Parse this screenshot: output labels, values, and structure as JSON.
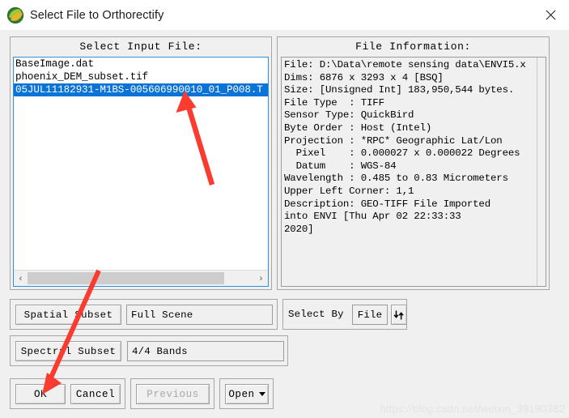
{
  "window": {
    "title": "Select File to Orthorectify",
    "icon": "envi-leaf-icon",
    "close_label": "close-icon"
  },
  "input_panel": {
    "title": "Select Input File:",
    "files": [
      {
        "name": "BaseImage.dat",
        "selected": false
      },
      {
        "name": "phoenix_DEM_subset.tif",
        "selected": false
      },
      {
        "name": "05JUL11182931-M1BS-005606990010_01_P008.T",
        "selected": true
      }
    ],
    "scroll_left_icon": "‹",
    "scroll_right_icon": "›"
  },
  "info_panel": {
    "title": "File Information:",
    "lines": [
      "File: D:\\Data\\remote sensing data\\ENVI5.x",
      "Dims: 6876 x 3293 x 4 [BSQ]",
      "Size: [Unsigned Int] 183,950,544 bytes.",
      "File Type  : TIFF",
      "Sensor Type: QuickBird",
      "Byte Order : Host (Intel)",
      "Projection : *RPC* Geographic Lat/Lon",
      "  Pixel    : 0.000027 x 0.000022 Degrees",
      "  Datum    : WGS-84",
      "Wavelength : 0.485 to 0.83 Micrometers",
      "Upper Left Corner: 1,1",
      "Description: GEO-TIFF File Imported",
      "into ENVI [Thu Apr 02 22:33:33",
      "2020]"
    ]
  },
  "controls": {
    "spatial_subset_label": "Spatial Subset",
    "spatial_subset_value": "Full Scene",
    "select_by_label": "Select By",
    "select_by_value": "File",
    "sort_icon": "down-up-arrows-icon",
    "spectral_subset_label": "Spectral Subset",
    "spectral_subset_value": "4/4 Bands"
  },
  "buttons": {
    "ok": "OK",
    "cancel": "Cancel",
    "previous": "Previous",
    "open": "Open"
  },
  "watermark": "https://blog.csdn.net/weixin_39190382",
  "annotations": {
    "accent_color": "#f93b30",
    "arrow1_target": "selected-file-row",
    "arrow2_target": "ok-button"
  }
}
